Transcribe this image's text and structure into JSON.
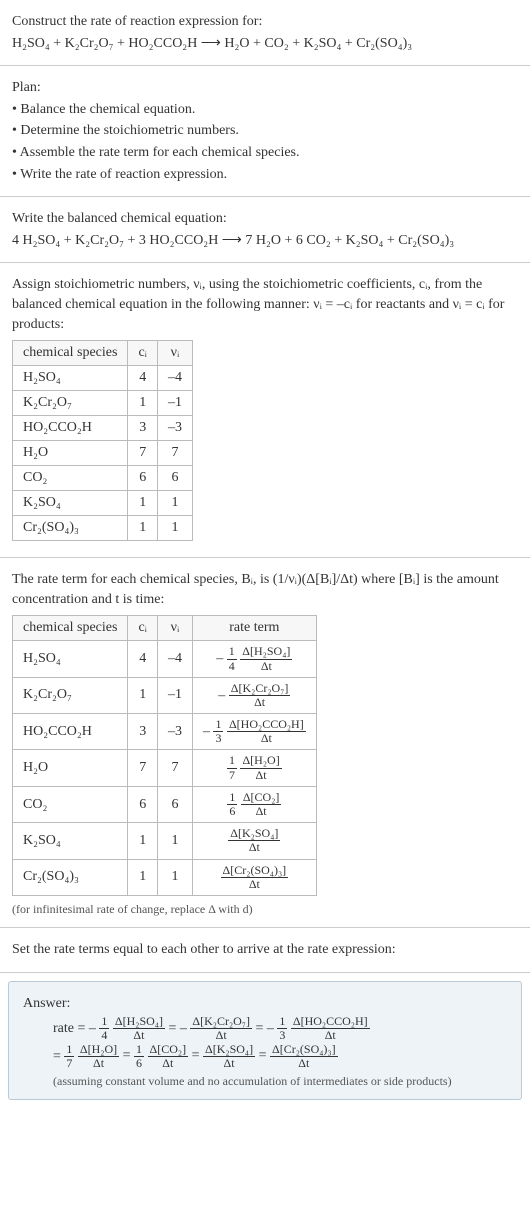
{
  "header": {
    "title": "Construct the rate of reaction expression for:",
    "equation": "H₂SO₄ + K₂Cr₂O₇ + HO₂CCO₂H ⟶ H₂O + CO₂ + K₂SO₄ + Cr₂(SO₄)₃"
  },
  "plan": {
    "title": "Plan:",
    "items": [
      "• Balance the chemical equation.",
      "• Determine the stoichiometric numbers.",
      "• Assemble the rate term for each chemical species.",
      "• Write the rate of reaction expression."
    ]
  },
  "balanced": {
    "title": "Write the balanced chemical equation:",
    "equation": "4 H₂SO₄ + K₂Cr₂O₇ + 3 HO₂CCO₂H ⟶ 7 H₂O + 6 CO₂ + K₂SO₄ + Cr₂(SO₄)₃"
  },
  "stoich": {
    "intro_a": "Assign stoichiometric numbers, νᵢ, using the stoichiometric coefficients, cᵢ, from the balanced chemical equation in the following manner: νᵢ = –cᵢ for reactants and νᵢ = cᵢ for products:",
    "table": {
      "headers": [
        "chemical species",
        "cᵢ",
        "νᵢ"
      ],
      "rows": [
        [
          "H₂SO₄",
          "4",
          "–4"
        ],
        [
          "K₂Cr₂O₇",
          "1",
          "–1"
        ],
        [
          "HO₂CCO₂H",
          "3",
          "–3"
        ],
        [
          "H₂O",
          "7",
          "7"
        ],
        [
          "CO₂",
          "6",
          "6"
        ],
        [
          "K₂SO₄",
          "1",
          "1"
        ],
        [
          "Cr₂(SO₄)₃",
          "1",
          "1"
        ]
      ]
    }
  },
  "rateterm": {
    "intro": "The rate term for each chemical species, Bᵢ, is (1/νᵢ)(Δ[Bᵢ]/Δt) where [Bᵢ] is the amount concentration and t is time:",
    "table": {
      "headers": [
        "chemical species",
        "cᵢ",
        "νᵢ",
        "rate term"
      ],
      "rows": [
        {
          "sp": "H₂SO₄",
          "c": "4",
          "v": "–4",
          "neg": "–",
          "fnum": "1",
          "fden": "4",
          "dnum": "Δ[H₂SO₄]",
          "dden": "Δt"
        },
        {
          "sp": "K₂Cr₂O₇",
          "c": "1",
          "v": "–1",
          "neg": "–",
          "fnum": "",
          "fden": "",
          "dnum": "Δ[K₂Cr₂O₇]",
          "dden": "Δt"
        },
        {
          "sp": "HO₂CCO₂H",
          "c": "3",
          "v": "–3",
          "neg": "–",
          "fnum": "1",
          "fden": "3",
          "dnum": "Δ[HO₂CCO₂H]",
          "dden": "Δt"
        },
        {
          "sp": "H₂O",
          "c": "7",
          "v": "7",
          "neg": "",
          "fnum": "1",
          "fden": "7",
          "dnum": "Δ[H₂O]",
          "dden": "Δt"
        },
        {
          "sp": "CO₂",
          "c": "6",
          "v": "6",
          "neg": "",
          "fnum": "1",
          "fden": "6",
          "dnum": "Δ[CO₂]",
          "dden": "Δt"
        },
        {
          "sp": "K₂SO₄",
          "c": "1",
          "v": "1",
          "neg": "",
          "fnum": "",
          "fden": "",
          "dnum": "Δ[K₂SO₄]",
          "dden": "Δt"
        },
        {
          "sp": "Cr₂(SO₄)₃",
          "c": "1",
          "v": "1",
          "neg": "",
          "fnum": "",
          "fden": "",
          "dnum": "Δ[Cr₂(SO₄)₃]",
          "dden": "Δt"
        }
      ]
    },
    "note": "(for infinitesimal rate of change, replace Δ with d)"
  },
  "final": {
    "title": "Set the rate terms equal to each other to arrive at the rate expression:"
  },
  "answer": {
    "label": "Answer:",
    "prefix": "rate =",
    "terms": [
      {
        "neg": "–",
        "fnum": "1",
        "fden": "4",
        "dnum": "Δ[H₂SO₄]",
        "dden": "Δt"
      },
      {
        "neg": "–",
        "fnum": "",
        "fden": "",
        "dnum": "Δ[K₂Cr₂O₇]",
        "dden": "Δt"
      },
      {
        "neg": "–",
        "fnum": "1",
        "fden": "3",
        "dnum": "Δ[HO₂CCO₂H]",
        "dden": "Δt"
      }
    ],
    "eq1": "=",
    "terms2": [
      {
        "neg": "",
        "fnum": "1",
        "fden": "7",
        "dnum": "Δ[H₂O]",
        "dden": "Δt"
      },
      {
        "neg": "",
        "fnum": "1",
        "fden": "6",
        "dnum": "Δ[CO₂]",
        "dden": "Δt"
      },
      {
        "neg": "",
        "fnum": "",
        "fden": "",
        "dnum": "Δ[K₂SO₄]",
        "dden": "Δt"
      },
      {
        "neg": "",
        "fnum": "",
        "fden": "",
        "dnum": "Δ[Cr₂(SO₄)₃]",
        "dden": "Δt"
      }
    ],
    "note": "(assuming constant volume and no accumulation of intermediates or side products)"
  }
}
